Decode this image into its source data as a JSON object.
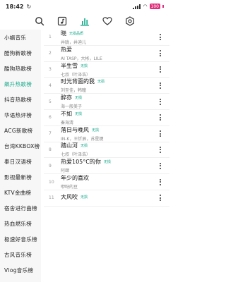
{
  "status": {
    "time": "18:42",
    "battery": "100"
  },
  "toolbar": {
    "icons": [
      "search-icon",
      "music-note-icon",
      "chart-icon",
      "heart-icon",
      "settings-icon"
    ],
    "active_color": "#12a889"
  },
  "sidebar": {
    "items": [
      {
        "label": "小蜗音乐"
      },
      {
        "label": "酷狗新歌榜"
      },
      {
        "label": "酷狗热歌榜"
      },
      {
        "label": "飙升热歌榜"
      },
      {
        "label": "抖音热歌榜"
      },
      {
        "label": "华语热评榜"
      },
      {
        "label": "ACG新歌榜"
      },
      {
        "label": "台湾KKBOX榜"
      },
      {
        "label": "奉日汉语榜"
      },
      {
        "label": "影视最新榜"
      },
      {
        "label": "KTV金曲榜"
      },
      {
        "label": "宿舍进行曲榜"
      },
      {
        "label": "热血燃乐榜"
      },
      {
        "label": "极速好音乐榜"
      },
      {
        "label": "古风音乐榜"
      },
      {
        "label": "Vlog音乐榜"
      }
    ],
    "active_index": 3
  },
  "songs": [
    {
      "num": "1",
      "title": "晓",
      "tag": "无损品质",
      "artist": "井胧，井迪儿"
    },
    {
      "num": "2",
      "title": "热爱",
      "tag": "",
      "artist": "AI TASP，大彬，LILE"
    },
    {
      "num": "3",
      "title": "半生雪",
      "tag": "无损",
      "artist": "七叔（叶泽浩）"
    },
    {
      "num": "4",
      "title": "时光背面的我",
      "tag": "无损",
      "artist": "刘至佳，韩瞳"
    },
    {
      "num": "5",
      "title": "醉亦",
      "tag": "无损",
      "artist": "海一般美子"
    },
    {
      "num": "6",
      "title": "不如",
      "tag": "无损",
      "artist": "秦海清"
    },
    {
      "num": "7",
      "title": "落日与晚风",
      "tag": "无损",
      "artist": "IN-K，王忻辰，苏星婕"
    },
    {
      "num": "8",
      "title": "踏山河",
      "tag": "无损",
      "artist": "七叔（叶泽浩）"
    },
    {
      "num": "9",
      "title": "热爱105°C的你",
      "tag": "无损",
      "artist": "阿肆"
    },
    {
      "num": "10",
      "title": "年少的喜欢",
      "tag": "",
      "artist": "咿呀的豆"
    },
    {
      "num": "11",
      "title": "大风吹",
      "tag": "无损",
      "artist": ""
    }
  ]
}
